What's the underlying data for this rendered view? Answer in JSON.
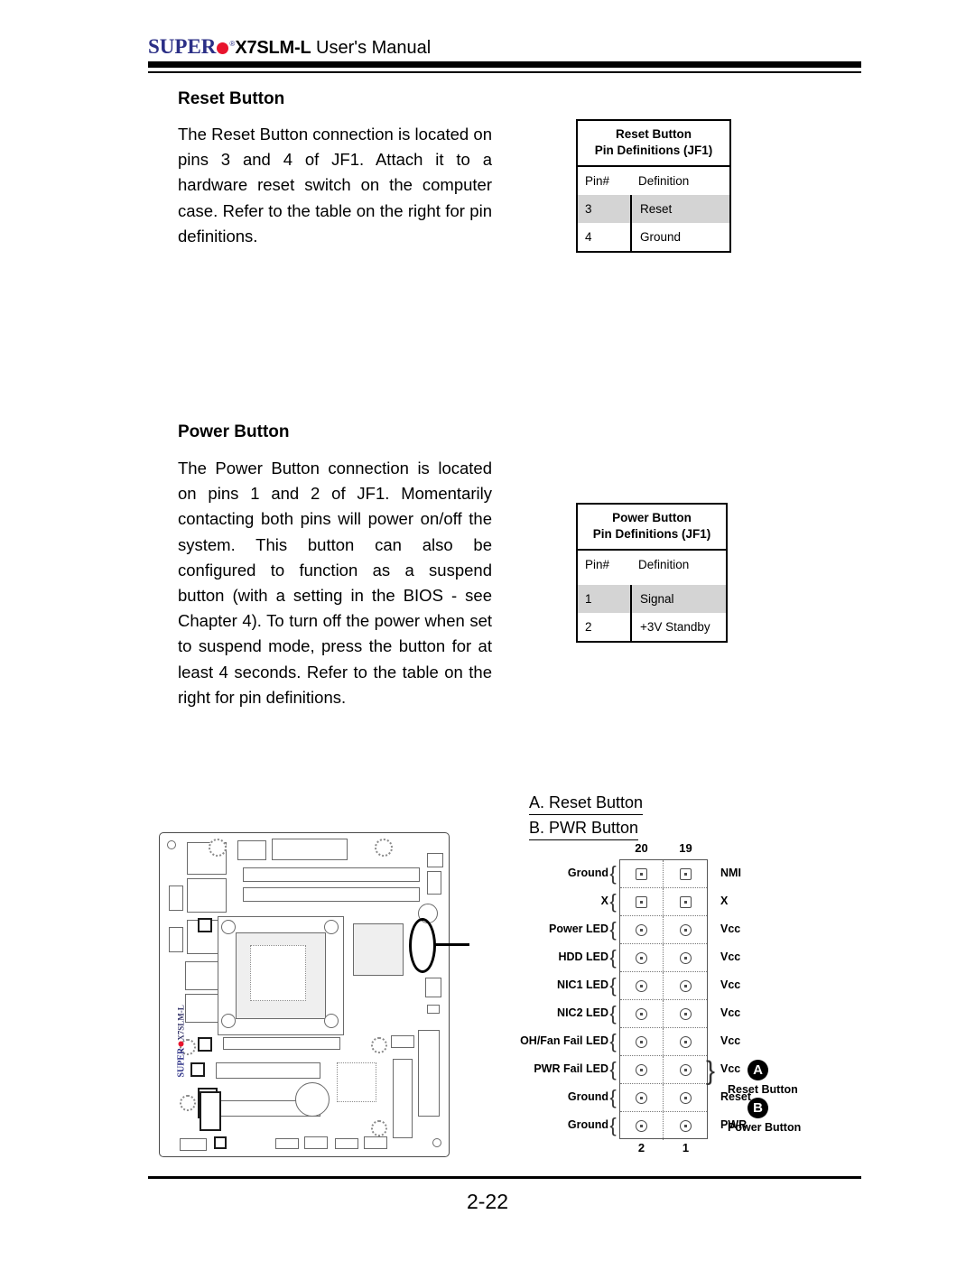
{
  "header": {
    "brand_super": "SUPER",
    "brand_dot_color": "#e8142d",
    "brand_color": "#2b2f86",
    "model": "X7SLM-L",
    "manual": " User's Manual"
  },
  "sections": [
    {
      "heading": "Reset Button",
      "body": "The Reset Button connection is located on pins 3 and 4 of JF1. Attach it to a hardware reset switch on the computer case. Refer to the table on the right for pin definitions."
    },
    {
      "heading": "Power Button",
      "body": "The Power Button connection is located on pins 1 and 2 of JF1. Momentarily contacting both pins will power on/off the system. This button can also be configured to function as a suspend button (with a setting in the BIOS - see Chapter 4). To turn off the power when set to suspend mode, press the button for at least 4 seconds. Refer to the table on the right for pin definitions."
    }
  ],
  "reset_table": {
    "caption_line1": "Reset Button",
    "caption_line2": "Pin Definitions (JF1)",
    "col_pin": "Pin#",
    "col_def": "Definition",
    "rows": [
      {
        "pin": "3",
        "definition": "Reset",
        "shaded": true
      },
      {
        "pin": "4",
        "definition": "Ground",
        "shaded": false
      }
    ]
  },
  "power_table": {
    "caption_line1": "Power Button",
    "caption_line2": "Pin Definitions (JF1)",
    "col_pin": "Pin#",
    "col_def": "Definition",
    "rows": [
      {
        "pin": "1",
        "definition": "Signal",
        "shaded": true
      },
      {
        "pin": "2",
        "definition": "+3V Standby",
        "shaded": false
      }
    ]
  },
  "figure_legend": {
    "item_a": "A. Reset Button",
    "item_b": "B. PWR Button"
  },
  "jf1_diagram": {
    "top_left_pin": "20",
    "top_right_pin": "19",
    "bottom_left_pin": "2",
    "bottom_right_pin": "1",
    "left_labels": [
      "Ground",
      "X",
      "Power LED",
      "HDD LED",
      "NIC1 LED",
      "NIC2 LED",
      "OH/Fan Fail LED",
      "PWR Fail LED",
      "Ground",
      "Ground"
    ],
    "right_labels": [
      "NMI",
      "X",
      "Vcc",
      "Vcc",
      "Vcc",
      "Vcc",
      "Vcc",
      "Vcc",
      "Reset",
      "PWR"
    ],
    "callouts": [
      {
        "badge": "A",
        "label": "Reset Button"
      },
      {
        "badge": "B",
        "label": "Power Button"
      }
    ]
  },
  "motherboard": {
    "silkscreen_brand": "SUPER",
    "silkscreen_model": "X7SLM-L"
  },
  "footer": {
    "page_number": "2-22"
  }
}
